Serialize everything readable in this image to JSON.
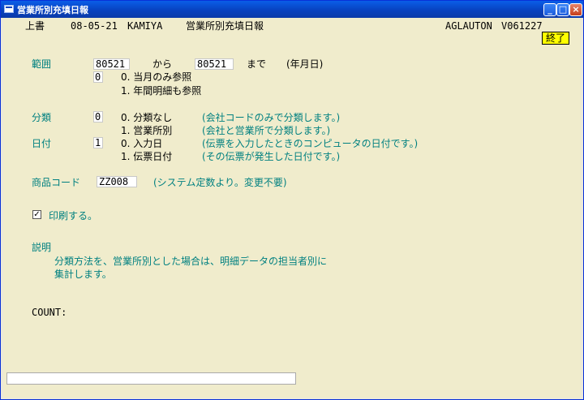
{
  "window": {
    "title": "営業所別充填日報"
  },
  "header": {
    "mode": "上書",
    "date": "08-05-21",
    "user": "KAMIYA",
    "report_title": "営業所別充填日報",
    "program": "AGLAUTON",
    "version": "V061227",
    "exit_label": "終了"
  },
  "range": {
    "label": "範囲",
    "from": "80521",
    "from_word": "から",
    "to": "80521",
    "to_word": "まで",
    "unit": "(年月日)",
    "option_value": "0",
    "option0": "0. 当月のみ参照",
    "option1": "1. 年間明細も参照"
  },
  "classification": {
    "label": "分類",
    "value": "0",
    "option0": "0. 分類なし",
    "option0_note": "(会社コードのみで分類します。)",
    "option1": "1. 営業所別",
    "option1_note": "(会社と営業所で分類します。)"
  },
  "date_type": {
    "label": "日付",
    "value": "1",
    "option0": "0. 入力日",
    "option0_note": "(伝票を入力したときのコンピュータの日付です。)",
    "option1": "1. 伝票日付",
    "option1_note": "(その伝票が発生した日付です。)"
  },
  "product": {
    "label": "商品コード",
    "value": "ZZ008",
    "note": "(システム定数より。変更不要)"
  },
  "print": {
    "label": "印刷する。",
    "checked": true,
    "check_mark": "✓"
  },
  "description": {
    "label": "説明",
    "line1": "分類方法を、営業所別とした場合は、明細データの担当者別に",
    "line2": "集計します。"
  },
  "count": {
    "label": "COUNT:"
  },
  "status_bar": {
    "text": ""
  }
}
